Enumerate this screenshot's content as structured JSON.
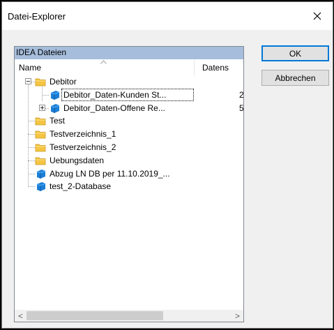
{
  "window": {
    "title": "Datei-Explorer"
  },
  "panel": {
    "header": "IDEA Dateien",
    "columns": {
      "name": "Name",
      "datens": "Datens"
    }
  },
  "tree": [
    {
      "label": "Debitor",
      "type": "folder",
      "expander": "minus",
      "indent": 0
    },
    {
      "label": "Debitor_Daten-Kunden St...",
      "type": "database",
      "indent": 1,
      "selected": true,
      "extra": "2"
    },
    {
      "label": "Debitor_Daten-Offene Re...",
      "type": "database",
      "indent": 1,
      "expander": "plus",
      "extra": "5"
    },
    {
      "label": "Test",
      "type": "folder",
      "indent": 0
    },
    {
      "label": "Testverzeichnis_1",
      "type": "folder",
      "indent": 0
    },
    {
      "label": "Testverzeichnis_2",
      "type": "folder",
      "indent": 0
    },
    {
      "label": "Uebungsdaten",
      "type": "folder",
      "indent": 0
    },
    {
      "label": "Abzug LN DB per 11.10.2019_...",
      "type": "database",
      "indent": 0
    },
    {
      "label": "test_2-Database",
      "type": "database",
      "indent": 0
    }
  ],
  "buttons": {
    "ok": "OK",
    "cancel": "Abbrechen"
  },
  "scrollbar": {
    "left_arrow": "<",
    "right_arrow": ">"
  },
  "colors": {
    "header_bg": "#a6bedc",
    "folder": "#f5c542",
    "database": "#1c7fd6"
  }
}
